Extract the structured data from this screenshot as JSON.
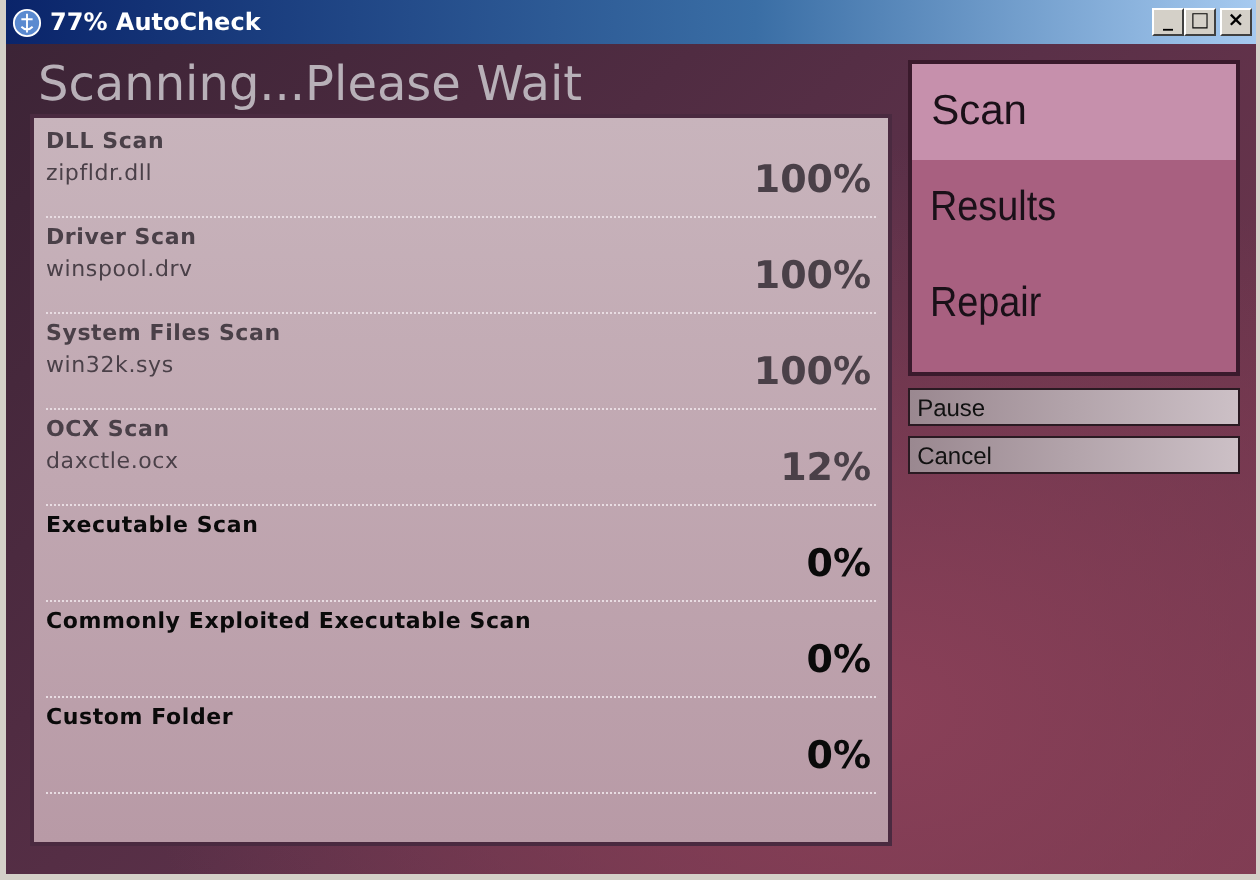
{
  "window": {
    "title": "77% AutoCheck",
    "controls": [
      "_",
      "□",
      "×"
    ]
  },
  "heading": "Scanning...Please Wait",
  "scans": [
    {
      "name": "DLL Scan",
      "file": "zipfldr.dll",
      "percent": "100%",
      "started": true
    },
    {
      "name": "Driver Scan",
      "file": "winspool.drv",
      "percent": "100%",
      "started": true
    },
    {
      "name": "System Files Scan",
      "file": "win32k.sys",
      "percent": "100%",
      "started": true
    },
    {
      "name": "OCX Scan",
      "file": "daxctle.ocx",
      "percent": "12%",
      "started": true
    },
    {
      "name": "Executable Scan",
      "percent": "0%",
      "started": false
    },
    {
      "name": "Commonly Exploited Executable Scan",
      "percent": "0%",
      "started": false
    },
    {
      "name": "Custom Folder",
      "percent": "0%",
      "started": false
    }
  ],
  "nav": [
    {
      "label": "Scan",
      "selected": true
    },
    {
      "label": "Results",
      "selected": false
    },
    {
      "label": "Repair",
      "selected": false
    }
  ],
  "buttons": [
    "Pause",
    "Cancel"
  ]
}
